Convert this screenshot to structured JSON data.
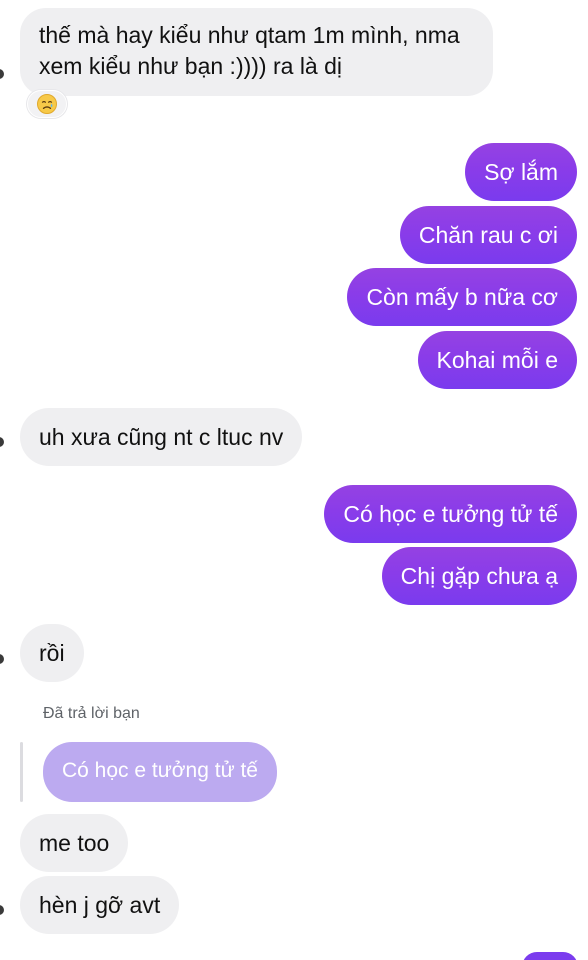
{
  "messages": [
    {
      "id": "m1",
      "direction": "in",
      "lines": [
        "thế mà hay kiểu như qtam 1m mình, nma",
        "xem kiểu như bạn :)))) ra là dị"
      ],
      "reaction": "crying-face"
    },
    {
      "id": "m2",
      "direction": "out",
      "text": "Sợ lắm"
    },
    {
      "id": "m3",
      "direction": "out",
      "text": "Chăn rau c ơi"
    },
    {
      "id": "m4",
      "direction": "out",
      "text": "Còn mấy b nữa cơ"
    },
    {
      "id": "m5",
      "direction": "out",
      "text": "Kohai mỗi e"
    },
    {
      "id": "m6",
      "direction": "in",
      "text": "uh xưa cũng nt c ltuc nv"
    },
    {
      "id": "m7",
      "direction": "out",
      "text": "Có học e tưởng tử tế"
    },
    {
      "id": "m8",
      "direction": "out",
      "text": "Chị gặp chưa ạ"
    },
    {
      "id": "m9",
      "direction": "in",
      "text": "rồi"
    },
    {
      "id": "m10",
      "direction": "in",
      "text": "me too",
      "reply_label": "Đã trả lời bạn",
      "quoted_text": "Có học e tưởng tử tế"
    },
    {
      "id": "m11",
      "direction": "in",
      "text": "hèn j gỡ avt"
    }
  ],
  "colors": {
    "incoming_bg": "#efeff1",
    "outgoing_top": "#9542e2",
    "outgoing_bottom": "#7a3bee",
    "quoted_bg": "#bcaaf0"
  }
}
